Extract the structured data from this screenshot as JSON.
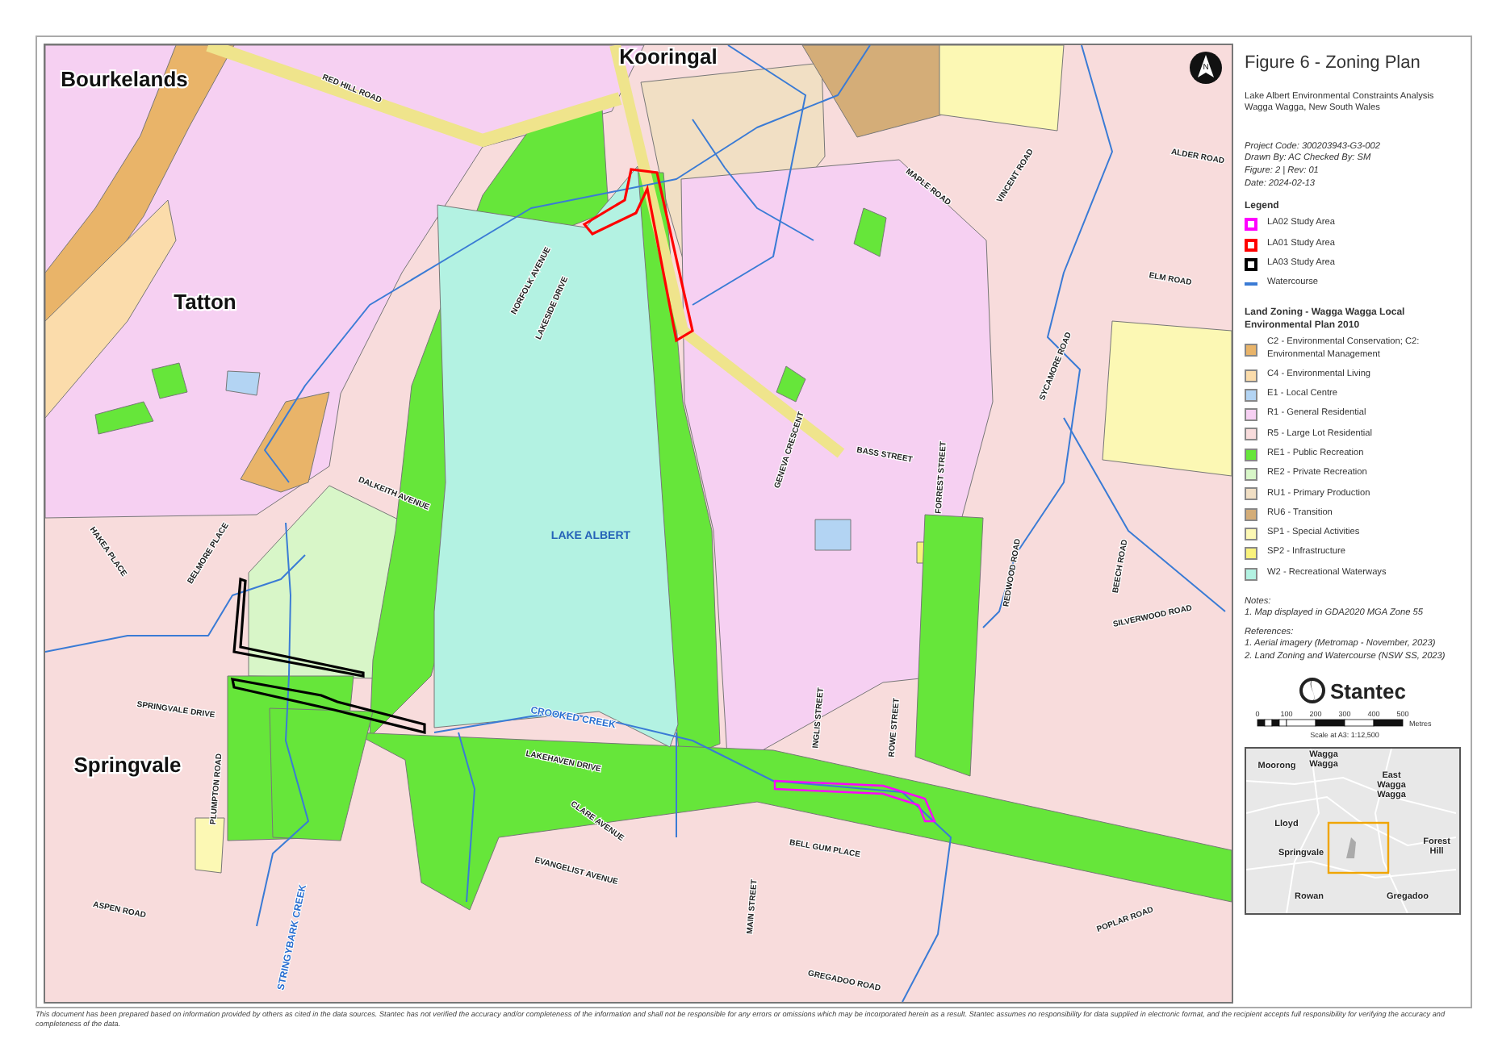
{
  "title": "Figure 6 - Zoning Plan",
  "subtitle": [
    "Lake Albert Environmental Constraints Analysis",
    "Wagga Wagga, New South Wales"
  ],
  "project_info": [
    "Project Code: 300203943-G3-002",
    "Drawn By: AC Checked By: SM",
    "Figure: 2 | Rev: 01",
    "Date: 2024-02-13"
  ],
  "legend": {
    "title": "Legend",
    "items": [
      {
        "kind": "outline",
        "label": "LA02 Study Area",
        "color": "#ff00ff"
      },
      {
        "kind": "outline",
        "label": "LA01 Study Area",
        "color": "#ff0000"
      },
      {
        "kind": "outline",
        "label": "LA03 Study Area",
        "color": "#000000"
      },
      {
        "kind": "line",
        "label": "Watercourse",
        "color": "#3a7bd5"
      }
    ]
  },
  "zoning": {
    "title": "Land Zoning - Wagga Wagga Local Environmental Plan 2010",
    "items": [
      {
        "label": "C2 - Environmental Conservation; C2: Environmental Management",
        "color": "#e9b469"
      },
      {
        "label": "C4 - Environmental Living",
        "color": "#fbdcab"
      },
      {
        "label": "E1 - Local Centre",
        "color": "#b3d4f3"
      },
      {
        "label": "R1 - General Residential",
        "color": "#f6d0f2"
      },
      {
        "label": "R5 - Large Lot Residential",
        "color": "#f8dcdc"
      },
      {
        "label": "RE1 - Public Recreation",
        "color": "#66e63a"
      },
      {
        "label": "RE2 - Private Recreation",
        "color": "#d8f6c8"
      },
      {
        "label": "RU1 - Primary Production",
        "color": "#f1dfc4"
      },
      {
        "label": "RU6 - Transition",
        "color": "#d4ad78"
      },
      {
        "label": "SP1 - Special Activities",
        "color": "#fcf8b4"
      },
      {
        "label": "SP2 - Infrastructure",
        "color": "#f9f27c"
      },
      {
        "label": "W2 - Recreational Waterways",
        "color": "#b3f2e2"
      }
    ]
  },
  "notes": {
    "heading": "Notes:",
    "items": [
      "1. Map displayed in GDA2020 MGA Zone 55"
    ]
  },
  "references": {
    "heading": "References:",
    "items": [
      "1. Aerial imagery (Metromap - November, 2023)",
      "2. Land Zoning and Watercourse (NSW SS, 2023)"
    ]
  },
  "logo": "Stantec",
  "scale_bar": {
    "ticks": [
      "0",
      "100",
      "200",
      "300",
      "400",
      "500"
    ],
    "unit": "Metres",
    "caption": "Scale at A3: 1:12,500"
  },
  "inset_map": {
    "labels": [
      "Moorong",
      "Wagga Wagga",
      "East Wagga Wagga",
      "Lloyd",
      "Springvale",
      "Forest Hill",
      "Rowan",
      "Gregadoo"
    ]
  },
  "north_arrow": {
    "label": "N"
  },
  "map": {
    "labels": [
      {
        "kind": "suburb",
        "text": "Bourkelands"
      },
      {
        "kind": "suburb",
        "text": "Kooringal"
      },
      {
        "kind": "suburb",
        "text": "Tatton"
      },
      {
        "kind": "suburb",
        "text": "Springvale"
      },
      {
        "kind": "road",
        "text": "RED HILL ROAD"
      },
      {
        "kind": "road",
        "text": "NORFOLK AVENUE"
      },
      {
        "kind": "road",
        "text": "LAKESIDE DRIVE"
      },
      {
        "kind": "road",
        "text": "DALKEITH AVENUE"
      },
      {
        "kind": "water",
        "text": "LAKE ALBERT"
      },
      {
        "kind": "road",
        "text": "HAKEA PLACE"
      },
      {
        "kind": "road",
        "text": "BELMORE PLACE"
      },
      {
        "kind": "road",
        "text": "SPRINGVALE DRIVE"
      },
      {
        "kind": "road",
        "text": "PLUMPTON ROAD"
      },
      {
        "kind": "road",
        "text": "ASPEN ROAD"
      },
      {
        "kind": "water",
        "text": "STRINGYBARK CREEK"
      },
      {
        "kind": "water",
        "text": "CROOKED CREEK"
      },
      {
        "kind": "road",
        "text": "LAKEHAVEN DRIVE"
      },
      {
        "kind": "road",
        "text": "CLARE AVENUE"
      },
      {
        "kind": "road",
        "text": "EVANGELIST AVENUE"
      },
      {
        "kind": "road",
        "text": "BELL GUM PLACE"
      },
      {
        "kind": "road",
        "text": "MAIN STREET"
      },
      {
        "kind": "road",
        "text": "GREGADOO ROAD"
      },
      {
        "kind": "road",
        "text": "POPLAR ROAD"
      },
      {
        "kind": "road",
        "text": "INGLIS STREET"
      },
      {
        "kind": "road",
        "text": "ROWE STREET"
      },
      {
        "kind": "road",
        "text": "GENEVA CRESCENT"
      },
      {
        "kind": "road",
        "text": "BASS STREET"
      },
      {
        "kind": "road",
        "text": "FORREST STREET"
      },
      {
        "kind": "road",
        "text": "MAPLE ROAD"
      },
      {
        "kind": "road",
        "text": "VINCENT ROAD"
      },
      {
        "kind": "road",
        "text": "ALDER ROAD"
      },
      {
        "kind": "road",
        "text": "ELM ROAD"
      },
      {
        "kind": "road",
        "text": "SYCAMORE ROAD"
      },
      {
        "kind": "road",
        "text": "SILVERWOOD ROAD"
      },
      {
        "kind": "road",
        "text": "REDWOOD ROAD"
      },
      {
        "kind": "road",
        "text": "BEECH ROAD"
      }
    ]
  },
  "disclaimer": "This document has been prepared based on information provided by others as cited in the data sources. Stantec has not verified the accuracy and/or completeness of the information and shall not be responsible for any errors or omissions which may be incorporated herein as a result. Stantec assumes no responsibility for data supplied in electronic format, and the recipient accepts full responsibility for verifying the accuracy and completeness of the data."
}
